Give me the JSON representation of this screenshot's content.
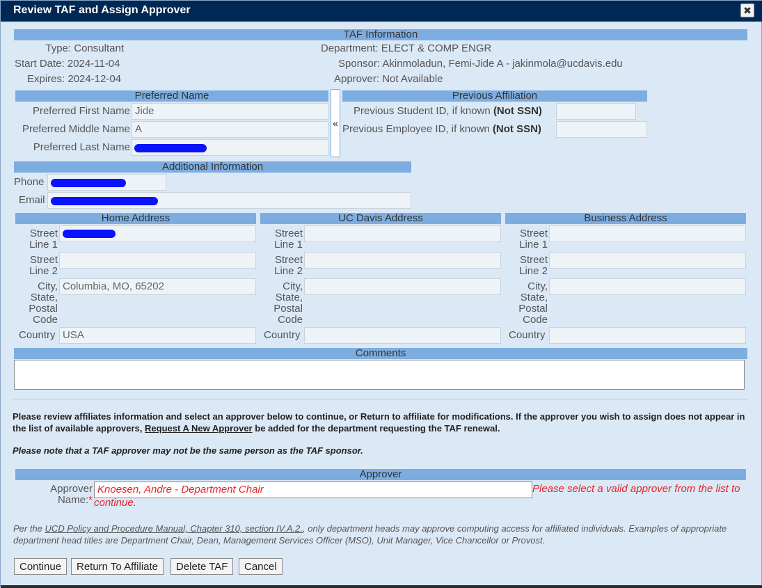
{
  "window": {
    "title": "Review TAF and Assign Approver",
    "close_glyph": "✖"
  },
  "taf_info": {
    "header": "TAF Information",
    "type_label": "Type:",
    "type_value": "Consultant",
    "start_label": "Start Date:",
    "start_value": "2024-11-04",
    "expires_label": "Expires:",
    "expires_value": "2024-12-04",
    "department_label": "Department:",
    "department_value": "ELECT & COMP ENGR",
    "sponsor_label": "Sponsor:",
    "sponsor_value": "Akinmoladun, Femi-Jide A - jakinmola@ucdavis.edu",
    "approver_label": "Approver:",
    "approver_value": "Not Available"
  },
  "preferred_name": {
    "header": "Preferred Name",
    "first_label": "Preferred First Name",
    "first_value": "Jide",
    "middle_label": "Preferred Middle Name",
    "middle_value": "A",
    "last_label": "Preferred Last Name",
    "last_value": ""
  },
  "collapse_glyph": "«",
  "previous_affiliation": {
    "header": "Previous Affiliation",
    "student_label": "Previous Student ID, if known",
    "student_bold": "(Not SSN)",
    "student_value": "",
    "employee_label": "Previous Employee ID, if known",
    "employee_bold": "(Not SSN)",
    "employee_value": ""
  },
  "additional_info": {
    "header": "Additional Information",
    "phone_label": "Phone",
    "phone_value": "",
    "email_label": "Email",
    "email_value": ""
  },
  "home_address": {
    "header": "Home Address",
    "street1_label": "Street Line 1",
    "street1_value": "",
    "street2_label": "Street Line 2",
    "street2_value": "",
    "city_label": "City, State, Postal Code",
    "city_value": "Columbia, MO, 65202",
    "country_label": "Country",
    "country_value": "USA"
  },
  "ucd_address": {
    "header": "UC Davis Address",
    "street1_label": "Street Line 1",
    "street1_value": "",
    "street2_label": "Street Line 2",
    "street2_value": "",
    "city_label": "City, State, Postal Code",
    "city_value": "",
    "country_label": "Country",
    "country_value": ""
  },
  "business_address": {
    "header": "Business Address",
    "street1_label": "Street Line 1",
    "street1_value": "",
    "street2_label": "Street Line 2",
    "street2_value": "",
    "city_label": "City, State, Postal Code",
    "city_value": "",
    "country_label": "Country",
    "country_value": ""
  },
  "comments": {
    "header": "Comments",
    "value": ""
  },
  "instructions": {
    "part1": "Please review affiliates information and select an approver below to continue, or Return to affiliate for modifications. If the approver you wish to assign does not appear in the list of available approvers,",
    "link": "Request A New Approver",
    "part2": "be added for the department requesting the TAF renewal.",
    "note": "Please note that a TAF approver may not be the same person as the TAF sponsor."
  },
  "approver": {
    "header": "Approver",
    "label": "Approver Name:",
    "required": "*",
    "value": "Knoesen, Andre - Department Chair",
    "error": "Please select a valid approver from the list to continue."
  },
  "policy": {
    "part1": "Per the",
    "link": "UCD Policy and Procedure Manual, Chapter 310, section IV.A.2.",
    "part2": ", only department heads may approve computing access for affiliated individuals. Examples of appropriate department head titles are Department Chair, Dean, Management Services Officer (MSO), Unit Manager, Vice Chancellor or Provost."
  },
  "buttons": {
    "continue": "Continue",
    "return": "Return To Affiliate",
    "delete": "Delete TAF",
    "cancel": "Cancel"
  },
  "colors": {
    "titlebar": "#002855",
    "band": "#7dade0",
    "panel": "#dbe8f5",
    "error": "#e8232a",
    "redaction": "#0a12ff"
  }
}
